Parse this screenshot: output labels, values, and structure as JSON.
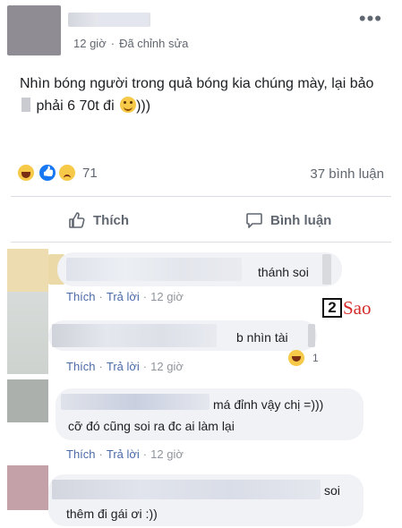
{
  "post": {
    "time": "12 giờ",
    "separator": "·",
    "edited": "Đã chỉnh sửa",
    "more": "•••",
    "text_part1": "Nhìn bóng người trong quả bóng kia chúng mày, lại bảo",
    "text_part2": "phải 6 70t đi",
    "text_part3": ")))",
    "reaction_count": "71",
    "comment_count": "37 bình luận",
    "like_label": "Thích",
    "comment_label": "Bình luận"
  },
  "comments": [
    {
      "text": "thánh soi",
      "like": "Thích",
      "reply": "Trả lời",
      "sep": "·",
      "time": "12 giờ"
    },
    {
      "text": "b nhìn tài",
      "like": "Thích",
      "reply": "Trả lời",
      "sep": "·",
      "time": "12 giờ",
      "reaction_count": "1"
    },
    {
      "line1": "má đỉnh vậy chị =)))",
      "line2": "cỡ đó cũng soi ra đc ai làm lại",
      "like": "Thích",
      "reply": "Trả lời",
      "sep": "·",
      "time": "12 giờ"
    },
    {
      "line1": "soi",
      "line2": "thêm đi gái ơi :))"
    }
  ],
  "watermark": {
    "num": "2",
    "text": "Sao"
  },
  "icons": [
    "more-icon",
    "haha-reaction-icon",
    "like-reaction-icon",
    "sad-reaction-icon",
    "thumbs-up-icon",
    "speech-bubble-icon",
    "smile-emoji-icon"
  ],
  "colors": {
    "link": "#4b6aa8",
    "meta": "#616770",
    "bubble": "#f0f2f5",
    "like_blue": "#1877f2",
    "watermark_red": "#d52a2a"
  }
}
